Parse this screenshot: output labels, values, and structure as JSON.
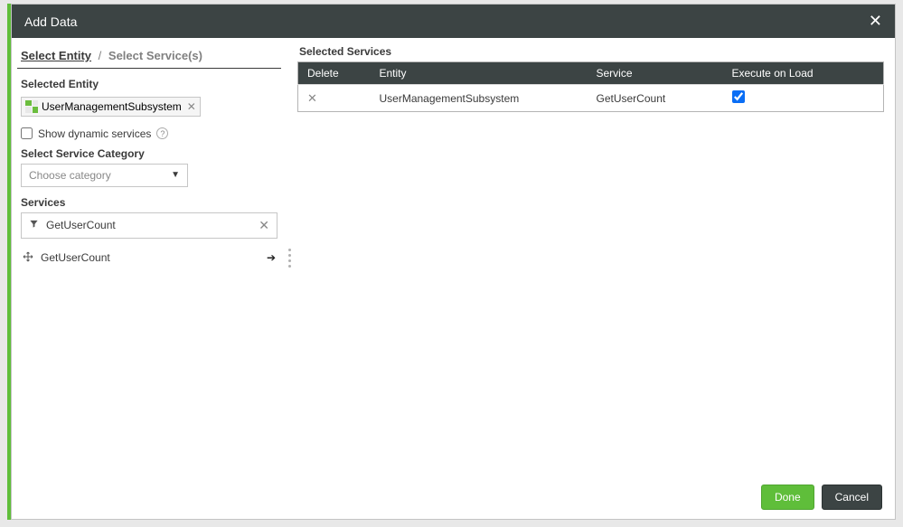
{
  "header": {
    "title": "Add Data"
  },
  "left": {
    "breadcrumb_entity": "Select Entity",
    "breadcrumb_services": "Select Service(s)",
    "selected_entity_label": "Selected Entity",
    "entity_name": "UserManagementSubsystem",
    "show_dynamic_label": "Show dynamic services",
    "select_category_label": "Select Service Category",
    "category_placeholder": "Choose category",
    "services_label": "Services",
    "filter_value": "GetUserCount",
    "service_items": [
      "GetUserCount"
    ]
  },
  "right": {
    "selected_services_label": "Selected Services",
    "headers": {
      "delete": "Delete",
      "entity": "Entity",
      "service": "Service",
      "execute_on_load": "Execute on Load"
    },
    "rows": [
      {
        "entity": "UserManagementSubsystem",
        "service": "GetUserCount",
        "execute_on_load": true
      }
    ]
  },
  "footer": {
    "done": "Done",
    "cancel": "Cancel"
  }
}
